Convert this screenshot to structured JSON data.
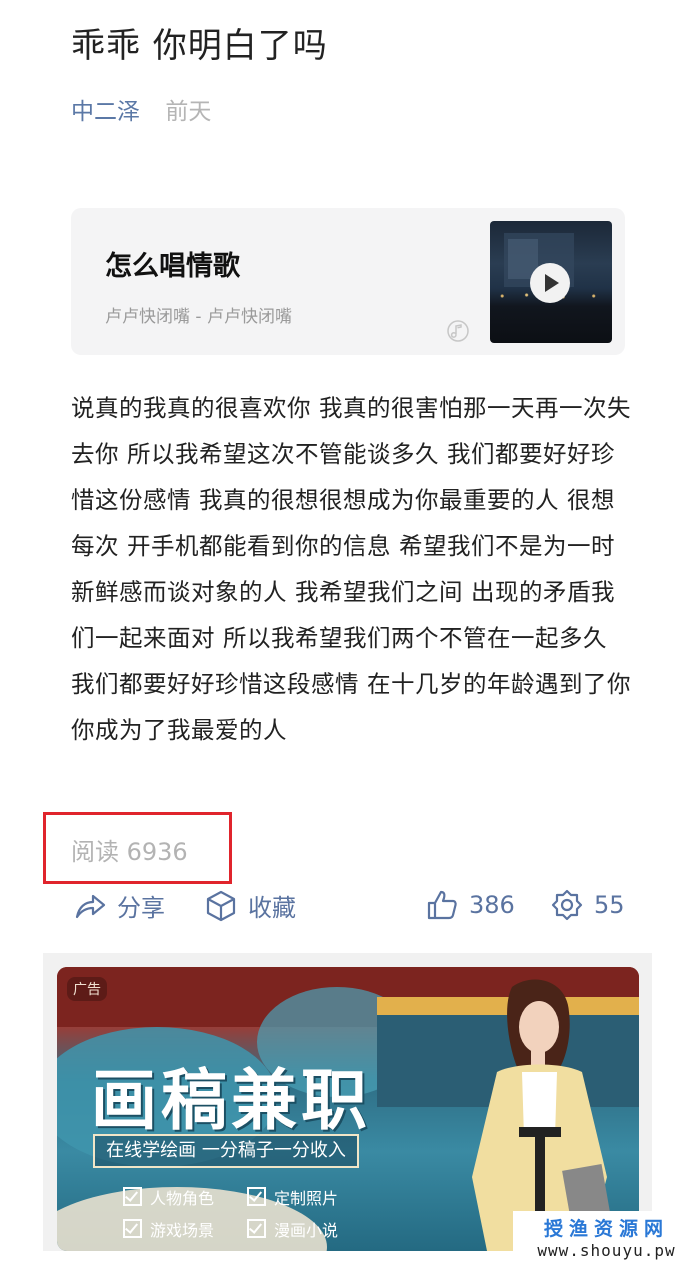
{
  "post": {
    "title": "乖乖 你明白了吗",
    "author": "中二泽",
    "time": "前天"
  },
  "music": {
    "song": "怎么唱情歌",
    "artist_line": "卢卢快闭嘴 - 卢卢快闭嘴",
    "note_icon": "music-note-icon",
    "play_icon": "play-icon"
  },
  "body_text": "说真的我真的很喜欢你 我真的很害怕那一天再一次失去你 所以我希望这次不管能谈多久 我们都要好好珍惜这份感情 我真的很想很想成为你最重要的人 很想每次 开手机都能看到你的信息 希望我们不是为一时新鲜感而谈对象的人 我希望我们之间 出现的矛盾我们一起来面对 所以我希望我们两个不管在一起多久 我们都要好好珍惜这段感情 在十几岁的年龄遇到了你 你成为了我最爱的人",
  "stats": {
    "read_label": "阅读 6936",
    "highlight_color": "#e0242c"
  },
  "actions": {
    "share": "分享",
    "favorite": "收藏",
    "likes": "386",
    "comments": "55"
  },
  "ad": {
    "tag": "广告",
    "headline": "画稿兼职",
    "subline": "在线学绘画 一分稿子一分收入",
    "features": [
      "人物角色",
      "定制照片",
      "游戏场景",
      "漫画小说"
    ]
  },
  "watermark": {
    "line1": "授渔资源网",
    "line2": "www.shouyu.pw"
  },
  "colors": {
    "accent": "#5a73a0",
    "author": "#5b78a6",
    "muted": "#b3b3b3"
  }
}
